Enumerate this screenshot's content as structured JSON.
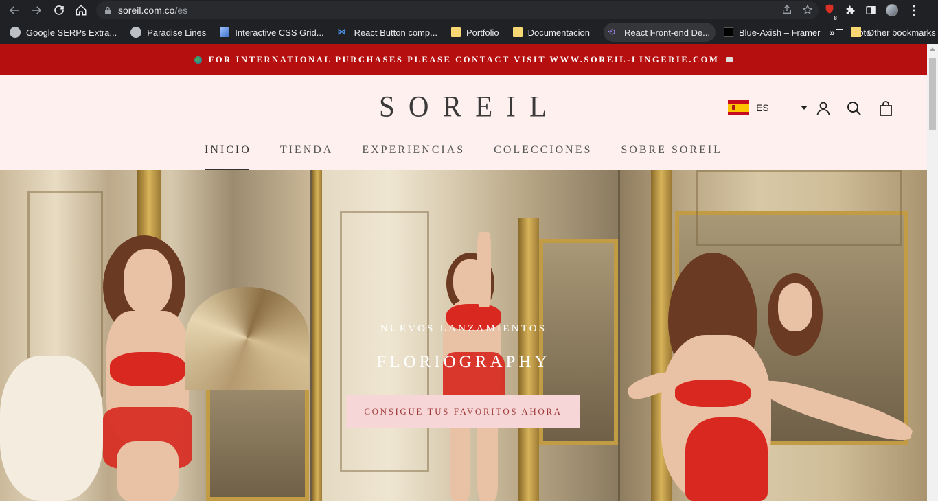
{
  "browser": {
    "url_host": "soreil.com.co",
    "url_path": "/es",
    "extension_badge": "8",
    "bookmarks": [
      {
        "label": "Google SERPs Extra...",
        "icon": "globe-icon"
      },
      {
        "label": "Paradise Lines",
        "icon": "globe-icon"
      },
      {
        "label": "Interactive CSS Grid...",
        "icon": "cube-icon"
      },
      {
        "label": "React Button comp...",
        "icon": "react-icon"
      },
      {
        "label": "Portfolio",
        "icon": "folder-icon"
      },
      {
        "label": "Documentacion",
        "icon": "folder-icon"
      },
      {
        "label": "React Front-end De...",
        "icon": "framer-purple-icon"
      },
      {
        "label": "Blue-Axish – Framer",
        "icon": "framer-icon"
      },
      {
        "label": "Moto",
        "icon": "page-icon"
      }
    ],
    "overflow": "»",
    "other_bookmarks": "Other bookmarks"
  },
  "announcement": {
    "text": "FOR INTERNATIONAL PURCHASES PLEASE CONTACT VISIT WWW.SOREIL-LINGERIE.COM"
  },
  "header": {
    "logo_letters": [
      "S",
      "O",
      "R",
      "E",
      "I",
      "L"
    ],
    "locale": "ES",
    "nav": [
      {
        "label": "INICIO",
        "active": true
      },
      {
        "label": "TIENDA",
        "active": false
      },
      {
        "label": "EXPERIENCIAS",
        "active": false
      },
      {
        "label": "COLECCIONES",
        "active": false
      },
      {
        "label": "SOBRE SOREIL",
        "active": false
      }
    ]
  },
  "hero": {
    "subtitle": "NUEVOS LANZAMIENTOS",
    "title": "FLORIOGRAPHY",
    "cta": "CONSIGUE TUS FAVORITOS AHORA"
  },
  "colors": {
    "announcement_bg": "#b50f0f",
    "header_bg": "#fdf0ef",
    "cta_bg": "#f6d6d6",
    "cta_text": "#a03a3a"
  }
}
